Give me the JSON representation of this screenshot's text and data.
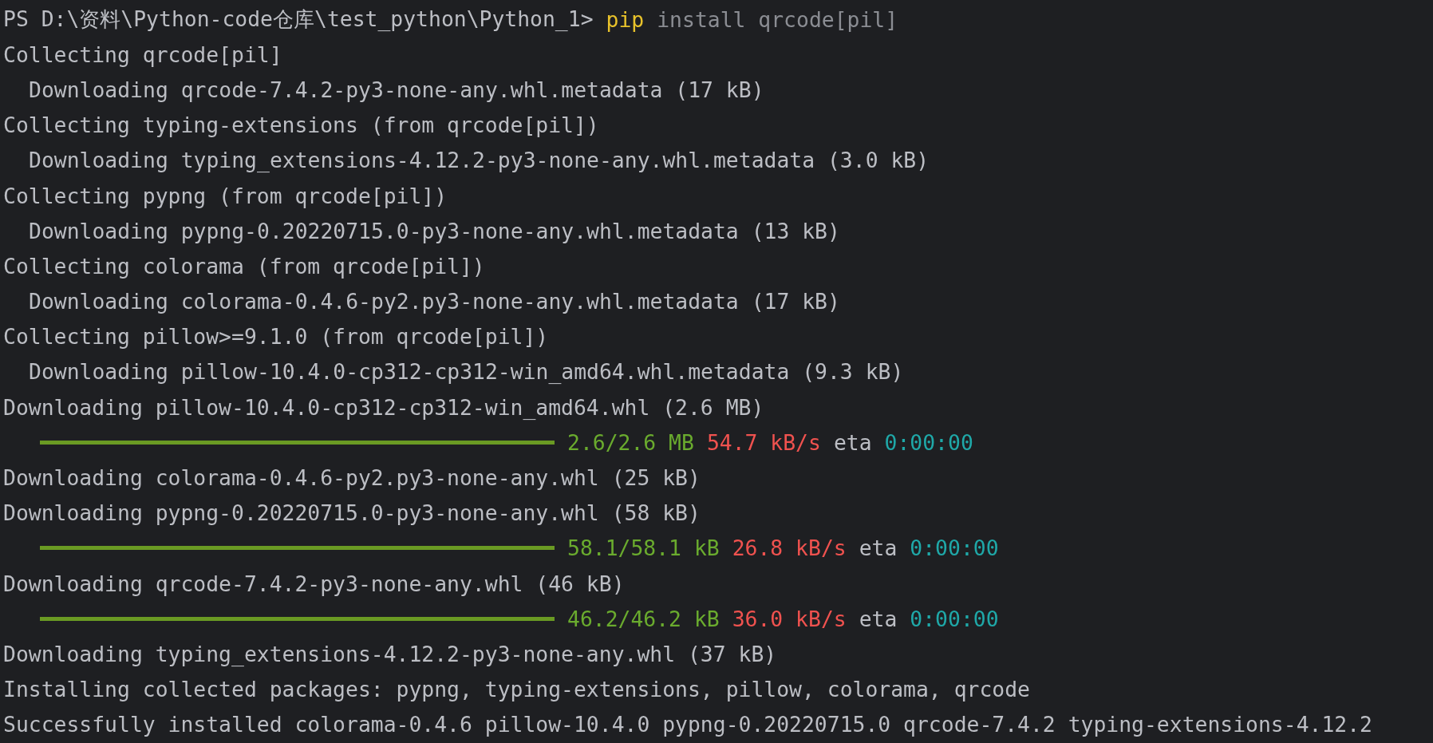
{
  "terminal": {
    "lines": [
      {
        "kind": "prompt",
        "segments": [
          {
            "kind": "prompt",
            "text": "PS D:\\资料\\Python-code仓库\\test_python\\Python_1>"
          },
          {
            "kind": "command",
            "text": "pip"
          },
          {
            "kind": "argument",
            "text": "install qrcode[pil]"
          }
        ]
      },
      {
        "kind": "step",
        "segments": [
          {
            "kind": "plain",
            "text": "Collecting qrcode[pil]"
          }
        ]
      },
      {
        "kind": "detail",
        "segments": [
          {
            "kind": "plain",
            "text": "Downloading qrcode-7.4.2-py3-none-any.whl.metadata (17 kB)"
          }
        ]
      },
      {
        "kind": "step",
        "segments": [
          {
            "kind": "plain",
            "text": "Collecting typing-extensions (from qrcode[pil])"
          }
        ]
      },
      {
        "kind": "detail",
        "segments": [
          {
            "kind": "plain",
            "text": "Downloading typing_extensions-4.12.2-py3-none-any.whl.metadata (3.0 kB)"
          }
        ]
      },
      {
        "kind": "step",
        "segments": [
          {
            "kind": "plain",
            "text": "Collecting pypng (from qrcode[pil])"
          }
        ]
      },
      {
        "kind": "detail",
        "segments": [
          {
            "kind": "plain",
            "text": "Downloading pypng-0.20220715.0-py3-none-any.whl.metadata (13 kB)"
          }
        ]
      },
      {
        "kind": "step",
        "segments": [
          {
            "kind": "plain",
            "text": "Collecting colorama (from qrcode[pil])"
          }
        ]
      },
      {
        "kind": "detail",
        "segments": [
          {
            "kind": "plain",
            "text": "Downloading colorama-0.4.6-py2.py3-none-any.whl.metadata (17 kB)"
          }
        ]
      },
      {
        "kind": "step",
        "segments": [
          {
            "kind": "plain",
            "text": "Collecting pillow>=9.1.0 (from qrcode[pil])"
          }
        ]
      },
      {
        "kind": "detail",
        "segments": [
          {
            "kind": "plain",
            "text": "Downloading pillow-10.4.0-cp312-cp312-win_amd64.whl.metadata (9.3 kB)"
          }
        ]
      },
      {
        "kind": "step",
        "segments": [
          {
            "kind": "plain",
            "text": "Downloading pillow-10.4.0-cp312-cp312-win_amd64.whl (2.6 MB)"
          }
        ]
      },
      {
        "kind": "progress",
        "segments": [
          {
            "kind": "progress",
            "level": 1
          },
          {
            "kind": "size",
            "text": "2.6/2.6 MB"
          },
          {
            "kind": "speed",
            "text": "54.7 kB/s"
          },
          {
            "kind": "label",
            "text": "eta"
          },
          {
            "kind": "eta",
            "text": "0:00:00"
          }
        ]
      },
      {
        "kind": "step",
        "segments": [
          {
            "kind": "plain",
            "text": "Downloading colorama-0.4.6-py2.py3-none-any.whl (25 kB)"
          }
        ]
      },
      {
        "kind": "step",
        "segments": [
          {
            "kind": "plain",
            "text": "Downloading pypng-0.20220715.0-py3-none-any.whl (58 kB)"
          }
        ]
      },
      {
        "kind": "progress",
        "segments": [
          {
            "kind": "progress",
            "level": 1
          },
          {
            "kind": "size",
            "text": "58.1/58.1 kB"
          },
          {
            "kind": "speed",
            "text": "26.8 kB/s"
          },
          {
            "kind": "label",
            "text": "eta"
          },
          {
            "kind": "eta",
            "text": "0:00:00"
          }
        ]
      },
      {
        "kind": "step",
        "segments": [
          {
            "kind": "plain",
            "text": "Downloading qrcode-7.4.2-py3-none-any.whl (46 kB)"
          }
        ]
      },
      {
        "kind": "progress",
        "segments": [
          {
            "kind": "progress",
            "level": 1
          },
          {
            "kind": "size",
            "text": "46.2/46.2 kB"
          },
          {
            "kind": "speed",
            "text": "36.0 kB/s"
          },
          {
            "kind": "label",
            "text": "eta"
          },
          {
            "kind": "eta",
            "text": "0:00:00"
          }
        ]
      },
      {
        "kind": "step",
        "segments": [
          {
            "kind": "plain",
            "text": "Downloading typing_extensions-4.12.2-py3-none-any.whl (37 kB)"
          }
        ]
      },
      {
        "kind": "step",
        "segments": [
          {
            "kind": "plain",
            "text": "Installing collected packages: pypng, typing-extensions, pillow, colorama, qrcode"
          }
        ]
      },
      {
        "kind": "step",
        "segments": [
          {
            "kind": "plain",
            "text": "Successfully installed colorama-0.4.6 pillow-10.4.0 pypng-0.20220715.0 qrcode-7.4.2 typing-extensions-4.12.2"
          }
        ]
      }
    ]
  }
}
